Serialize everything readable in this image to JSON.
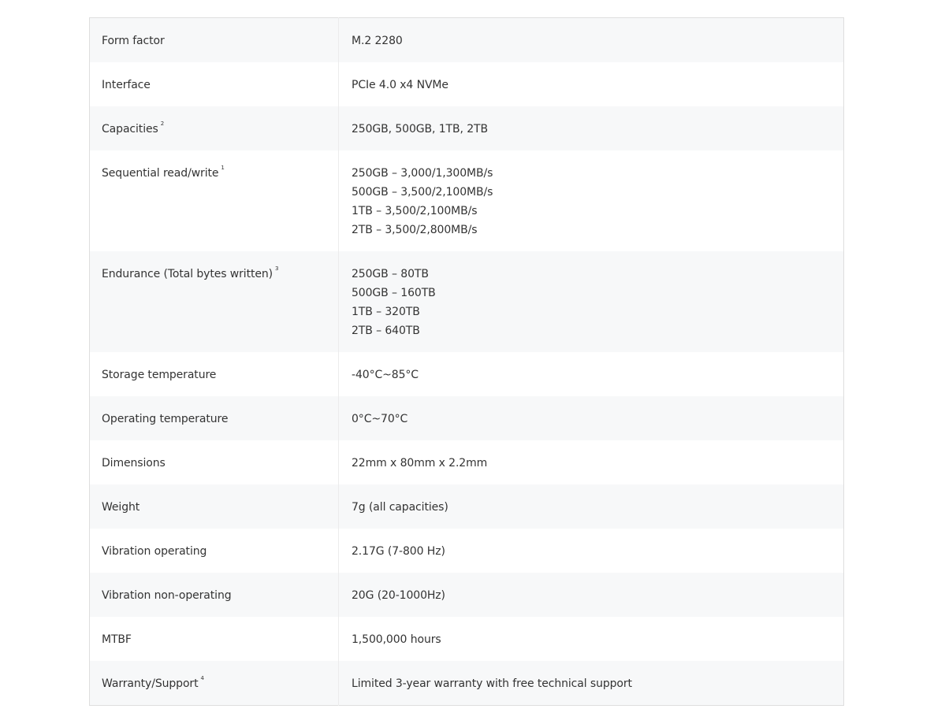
{
  "specs": [
    {
      "label": "Form factor",
      "note": "",
      "values": [
        "M.2 2280"
      ]
    },
    {
      "label": "Interface",
      "note": "",
      "values": [
        "PCIe 4.0 x4 NVMe"
      ]
    },
    {
      "label": "Capacities",
      "note": "2",
      "values": [
        "250GB, 500GB, 1TB, 2TB"
      ]
    },
    {
      "label": "Sequential read/write",
      "note": "1",
      "values": [
        "250GB – 3,000/1,300MB/s",
        "500GB – 3,500/2,100MB/s",
        "1TB – 3,500/2,100MB/s",
        "2TB – 3,500/2,800MB/s"
      ]
    },
    {
      "label": "Endurance (Total bytes written)",
      "note": "3",
      "values": [
        "250GB – 80TB",
        "500GB – 160TB",
        "1TB – 320TB",
        "2TB – 640TB"
      ]
    },
    {
      "label": "Storage temperature",
      "note": "",
      "values": [
        "-40°C~85°C"
      ]
    },
    {
      "label": "Operating temperature",
      "note": "",
      "values": [
        "0°C~70°C"
      ]
    },
    {
      "label": "Dimensions",
      "note": "",
      "values": [
        "22mm x 80mm x 2.2mm"
      ]
    },
    {
      "label": "Weight",
      "note": "",
      "values": [
        "7g (all capacities)"
      ]
    },
    {
      "label": "Vibration operating",
      "note": "",
      "values": [
        "2.17G (7-800 Hz)"
      ]
    },
    {
      "label": "Vibration non-operating",
      "note": "",
      "values": [
        "20G (20-1000Hz)"
      ]
    },
    {
      "label": "MTBF",
      "note": "",
      "values": [
        "1,500,000 hours"
      ]
    },
    {
      "label": "Warranty/Support",
      "note": "4",
      "values": [
        "Limited 3-year warranty with free technical support"
      ]
    }
  ]
}
